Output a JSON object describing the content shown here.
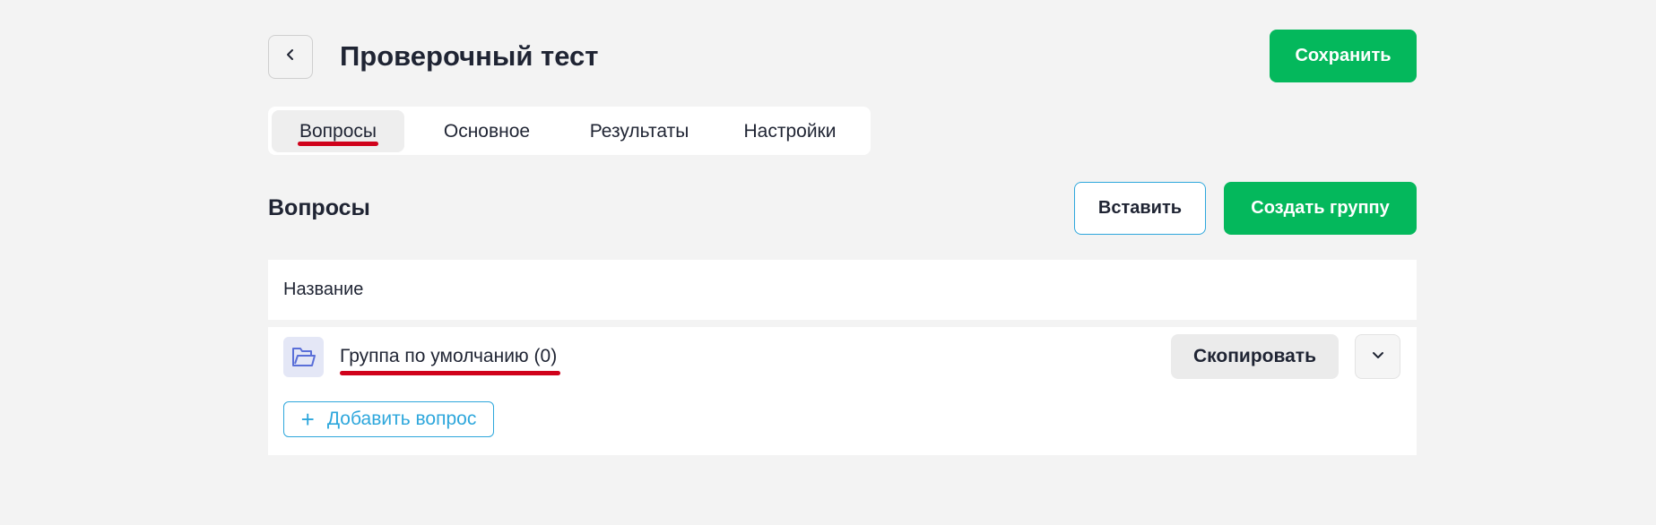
{
  "header": {
    "title": "Проверочный тест",
    "save_label": "Сохранить"
  },
  "tabs": [
    {
      "label": "Вопросы",
      "active": true
    },
    {
      "label": "Основное",
      "active": false
    },
    {
      "label": "Результаты",
      "active": false
    },
    {
      "label": "Настройки",
      "active": false
    }
  ],
  "section": {
    "title": "Вопросы",
    "paste_label": "Вставить",
    "create_group_label": "Создать группу"
  },
  "table": {
    "column_name": "Название",
    "groups": [
      {
        "name": "Группа по умолчанию (0)",
        "copy_label": "Скопировать",
        "add_question_label": "Добавить вопрос"
      }
    ]
  },
  "colors": {
    "accent_green": "#04b85c",
    "accent_blue": "#2ea7dc",
    "annotation_red": "#d0021b",
    "background": "#f3f3f3"
  },
  "icons": {
    "back": "chevron-left-icon",
    "folder": "folder-open-icon",
    "expand": "chevron-down-icon",
    "add": "plus-icon"
  }
}
